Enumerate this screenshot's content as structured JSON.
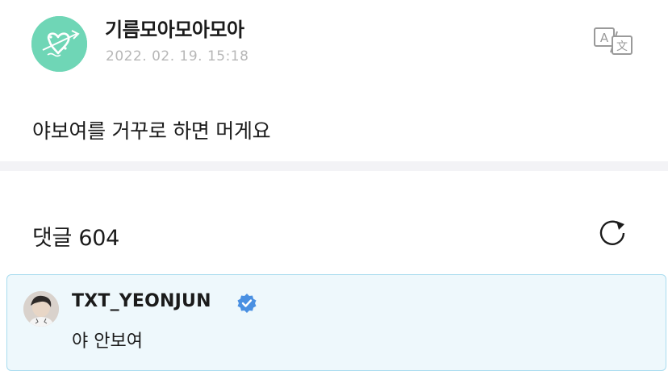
{
  "post": {
    "author": "기름모아모아모아",
    "timestamp": "2022. 02. 19. 15:18",
    "body": "야보여를 거꾸로 하면 머게요",
    "avatar_icon": "heart-doodle-avatar",
    "translate_icon": "translate-icon"
  },
  "comments": {
    "header": "댓글 604",
    "refresh_icon": "refresh-icon",
    "items": [
      {
        "author": "TXT_YEONJUN",
        "verified": true,
        "text": "야 안보여"
      }
    ]
  },
  "colors": {
    "accent_mint": "#6fd6b6",
    "verified_blue": "#4a90e2",
    "highlight_bg": "#eef8fc",
    "highlight_border": "#a9dcef",
    "divider": "#f3f3f6"
  }
}
